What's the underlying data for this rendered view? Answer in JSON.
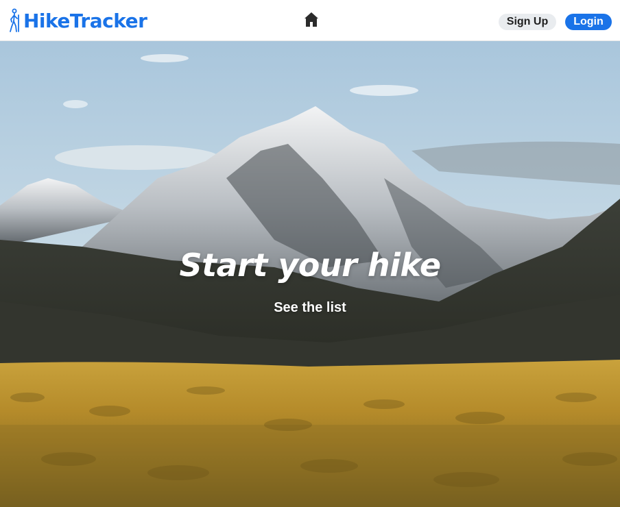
{
  "brand": {
    "name": "HikeTracker",
    "icon": "hiker-icon",
    "color": "#1a73e8"
  },
  "nav": {
    "home_icon": "home-icon"
  },
  "auth": {
    "signup_label": "Sign Up",
    "login_label": "Login"
  },
  "hero": {
    "title": "Start your hike",
    "link_label": "See the list",
    "background": "mountain-landscape-photo"
  },
  "colors": {
    "accent": "#1a73e8",
    "signup_bg": "#e9ecef",
    "text_light": "#ffffff"
  }
}
